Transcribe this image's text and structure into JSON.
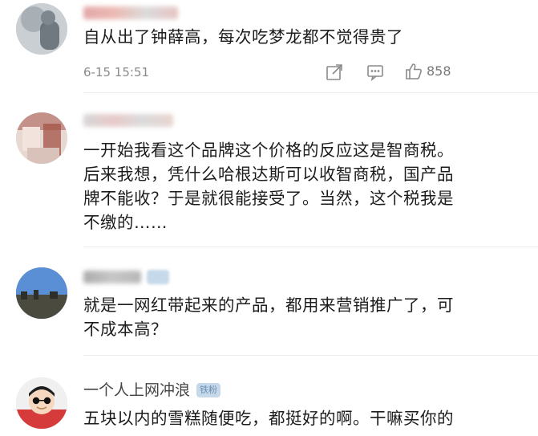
{
  "comments": [
    {
      "text_lines": [
        "自从出了钟薛高，每次吃梦龙都不觉得贵了"
      ],
      "time": "6-15 15:51",
      "like_count": "858",
      "icons": [
        "share-icon",
        "reply-icon",
        "like-icon"
      ]
    },
    {
      "text_lines": [
        "一开始我看这个品牌这个价格的反应这是智商税。",
        "后来我想，凭什么哈根达斯可以收智商税，国产品",
        "牌不能收？于是就很能接受了。当然，这个税我是",
        "不缴的……"
      ]
    },
    {
      "text_lines": [
        "就是一网红带起来的产品，都用来营销推广了，可",
        "不成本高？"
      ]
    },
    {
      "username": "一个人上网冲浪",
      "badge": "铁粉",
      "text_lines": [
        "五块以内的雪糕随便吃，都挺好的啊。干嘛买你的"
      ]
    }
  ],
  "colors": {
    "text": "#1c1c1c",
    "meta": "#8a8a8a",
    "badge_bg": "#c6d9ea",
    "badge_text": "#6b8fb2"
  }
}
